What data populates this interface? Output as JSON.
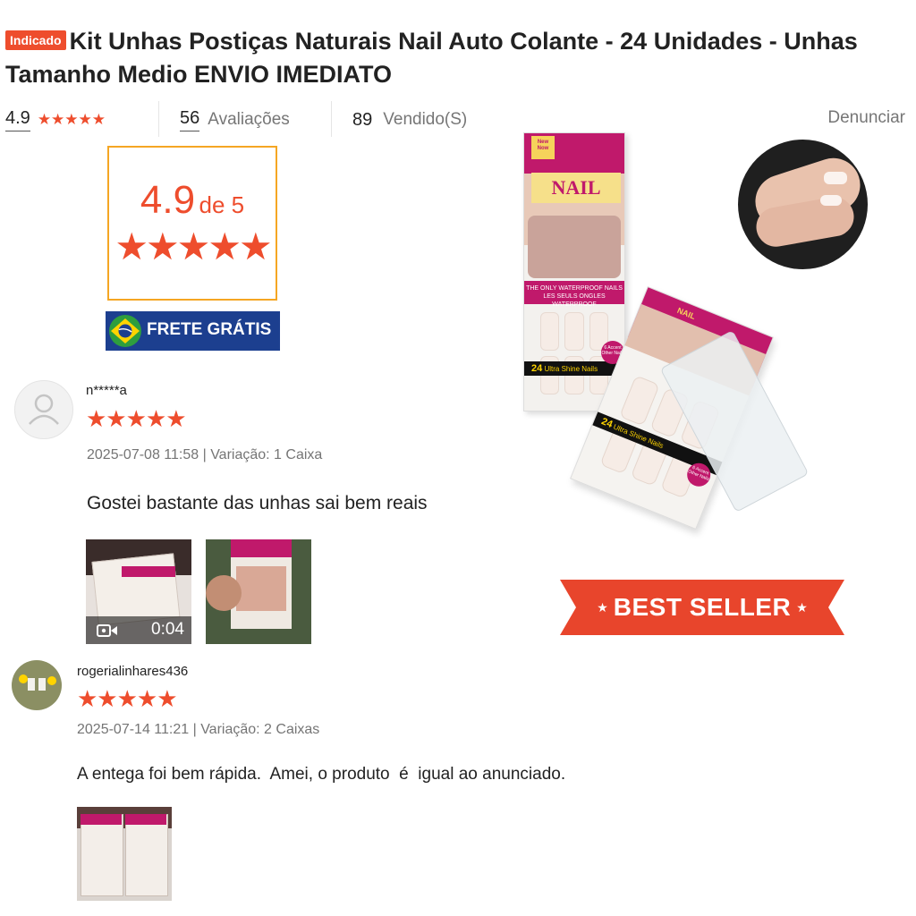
{
  "product": {
    "badge": "Indicado",
    "title": "Kit Unhas Postiças Naturais Nail Auto Colante - 24 Unidades - Unhas Tamanho Medio ENVIO IMEDIATO"
  },
  "stats": {
    "rating": "4.9",
    "reviews_count": "56",
    "reviews_label": "Avaliações",
    "sold_count": "89",
    "sold_label": "Vendido(S)",
    "report_label": "Denunciar"
  },
  "rating_box": {
    "score": "4.9",
    "of_label": "de 5",
    "stars": "★★★★★"
  },
  "frete": {
    "label": "FRETE GRÁTIS"
  },
  "product_image": {
    "box_brand": "NAIL",
    "box_small_brand": "NAIL",
    "box_new": "New Now",
    "box_line1": "THE ONLY WATERPROOF NAILS",
    "box_line2": "LES SEULS ONGLES WATERPROOF",
    "box_count": "24",
    "box_count_text": "Ultra Shine Nails",
    "box_accent": "6 Accent Other Nails",
    "box_count_2": "24",
    "box_count_text_2": "Ultra Shine Nails",
    "box_accent_2": "6 Accent Other Nails"
  },
  "banner": {
    "label": "BEST SELLER"
  },
  "reviews": [
    {
      "username": "n*****a",
      "stars": "★★★★★",
      "meta": "2025-07-08 11:58 | Variação: 1 Caixa",
      "text": "Gostei bastante das unhas sai bem reais",
      "video_duration": "0:04"
    },
    {
      "username": "rogerialinhares436",
      "stars": "★★★★★",
      "meta": "2025-07-14 11:21 | Variação: 2 Caixas",
      "text": "A entega foi bem rápida.  Amei, o produto  é  igual ao anunciado."
    }
  ],
  "colors": {
    "accent": "#ee4d2d",
    "box_border": "#f5a623",
    "frete_bg": "#1c3f8f",
    "banner": "#e8452c"
  }
}
